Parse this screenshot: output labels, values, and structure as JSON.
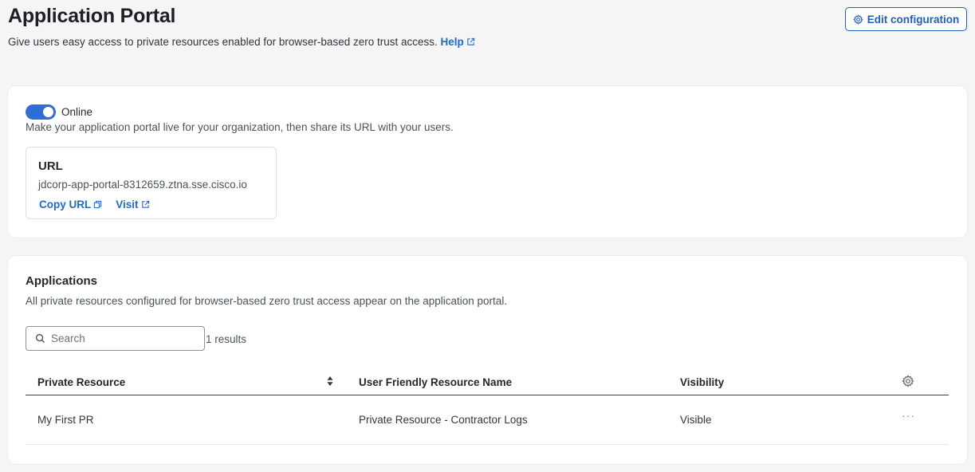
{
  "header": {
    "title": "Application Portal",
    "subtitle": "Give users easy access to private resources enabled for browser-based zero trust access.",
    "help_link": "Help",
    "edit_button": "Edit configuration"
  },
  "status_card": {
    "toggle_label": "Online",
    "toggle_on": true,
    "description": "Make your application portal live for your organization, then share its URL with your users.",
    "url_heading": "URL",
    "url_value": "jdcorp-app-portal-8312659.ztna.sse.cisco.io",
    "copy_url_link": "Copy URL",
    "visit_link": "Visit"
  },
  "applications": {
    "title": "Applications",
    "description": "All private resources configured for browser-based zero trust access appear on the application portal.",
    "search_placeholder": "Search",
    "results_text": "1 results",
    "columns": [
      "Private Resource",
      "User Friendly Resource Name",
      "Visibility"
    ],
    "rows": [
      {
        "private_resource": "My First PR",
        "friendly_name": "Private Resource - Contractor Logs",
        "visibility": "Visible"
      }
    ]
  },
  "colors": {
    "accent": "#1f6ad1",
    "toggle_on": "#2e6fd6",
    "background": "#f5f5f5"
  },
  "icons": [
    "external-link-icon",
    "gear-icon",
    "copy-icon",
    "search-icon",
    "sort-icon",
    "more-icon"
  ]
}
